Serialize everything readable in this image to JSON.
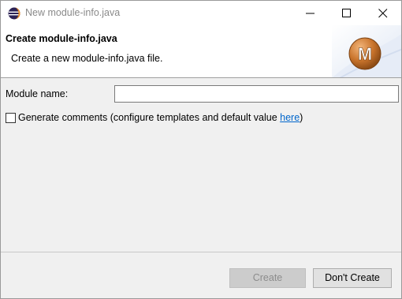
{
  "window": {
    "title": "New module-info.java"
  },
  "banner": {
    "title": "Create module-info.java",
    "description": "Create a new module-info.java file.",
    "logo_letter": "M",
    "logo_color": "#b8651f"
  },
  "form": {
    "module_name_label": "Module name:",
    "module_name_value": "",
    "generate_comments": {
      "checked": false,
      "text": "Generate comments (configure templates and default value ",
      "link": "here",
      "suffix": ")"
    }
  },
  "buttons": {
    "create": "Create",
    "dont_create": "Don't Create"
  }
}
